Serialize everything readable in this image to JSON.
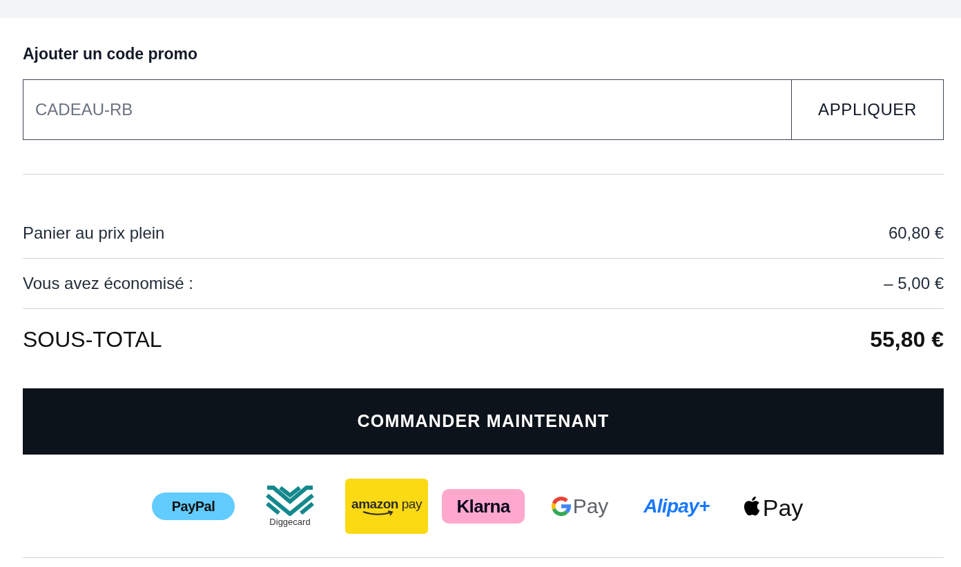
{
  "promo": {
    "heading": "Ajouter un code promo",
    "placeholder": "CADEAU-RB",
    "apply_button": "APPLIQUER"
  },
  "summary": [
    {
      "kind": "line",
      "label": "Panier au prix plein",
      "amount": "60,80 €"
    },
    {
      "kind": "line",
      "label": "Vous avez économisé :",
      "amount": "– 5,00 €"
    },
    {
      "kind": "total",
      "label": "SOUS-TOTAL",
      "amount": "55,80 €"
    }
  ],
  "checkout_button": "COMMANDER MAINTENANT",
  "payment_methods": [
    {
      "kind": "paypal",
      "text": "PayPal"
    },
    {
      "kind": "diggecard",
      "text": "Diggecard"
    },
    {
      "kind": "amazon",
      "text": "**amazon** pay"
    },
    {
      "kind": "klarna",
      "text": "Klarna"
    },
    {
      "kind": "gpay",
      "text": "Pay"
    },
    {
      "kind": "alipay",
      "text": "Alipay+"
    },
    {
      "kind": "applepay",
      "text": "Pay"
    }
  ]
}
